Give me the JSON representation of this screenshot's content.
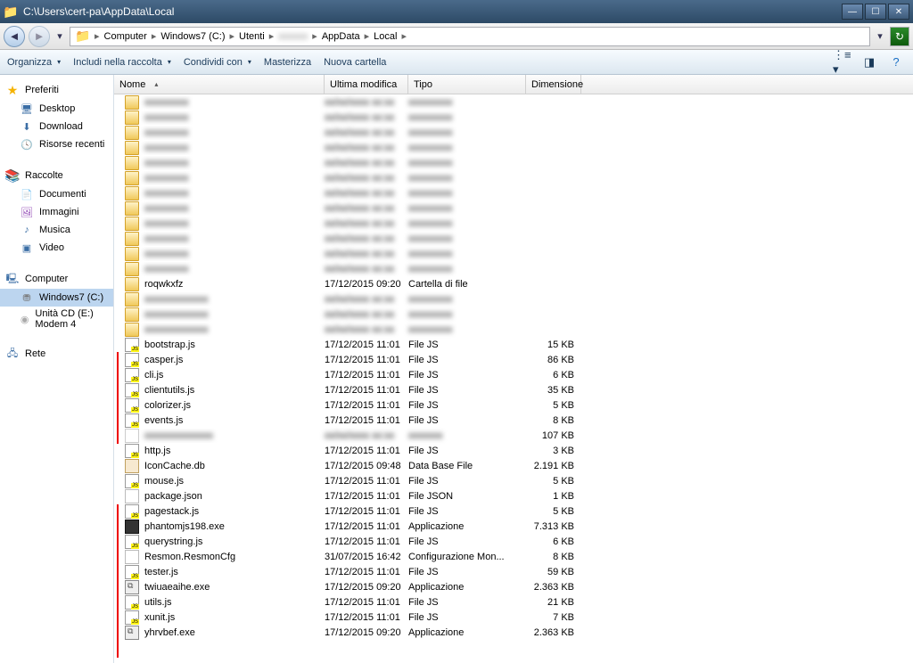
{
  "window": {
    "title": "C:\\Users\\cert-pa\\AppData\\Local"
  },
  "nav": {
    "crumbs": [
      "Computer",
      "Windows7 (C:)",
      "Utenti",
      "",
      "AppData",
      "Local"
    ]
  },
  "toolbar": {
    "organize": "Organizza",
    "include": "Includi nella raccolta",
    "share": "Condividi con",
    "burn": "Masterizza",
    "newfolder": "Nuova cartella"
  },
  "sidebar": {
    "favorites": "Preferiti",
    "desktop": "Desktop",
    "download": "Download",
    "recent": "Risorse recenti",
    "libraries": "Raccolte",
    "documents": "Documenti",
    "images": "Immagini",
    "music": "Musica",
    "video": "Video",
    "computer": "Computer",
    "drive_c": "Windows7 (C:)",
    "drive_cd": "Unità CD (E:) Modem 4",
    "network": "Rete"
  },
  "columns": {
    "name": "Nome",
    "modified": "Ultima modifica",
    "type": "Tipo",
    "size": "Dimensione"
  },
  "folders": {
    "roqwkxfz": {
      "name": "roqwkxfz",
      "modified": "17/12/2015 09:20",
      "type": "Cartella di file"
    }
  },
  "files": [
    {
      "name": "bootstrap.js",
      "modified": "17/12/2015 11:01",
      "type": "File JS",
      "size": "15 KB",
      "icon": "js"
    },
    {
      "name": "casper.js",
      "modified": "17/12/2015 11:01",
      "type": "File JS",
      "size": "86 KB",
      "icon": "js"
    },
    {
      "name": "cli.js",
      "modified": "17/12/2015 11:01",
      "type": "File JS",
      "size": "6 KB",
      "icon": "js"
    },
    {
      "name": "clientutils.js",
      "modified": "17/12/2015 11:01",
      "type": "File JS",
      "size": "35 KB",
      "icon": "js"
    },
    {
      "name": "colorizer.js",
      "modified": "17/12/2015 11:01",
      "type": "File JS",
      "size": "5 KB",
      "icon": "js"
    },
    {
      "name": "events.js",
      "modified": "17/12/2015 11:01",
      "type": "File JS",
      "size": "8 KB",
      "icon": "js"
    },
    {
      "name": "",
      "modified": "",
      "type": "",
      "size": "107 KB",
      "icon": "unknown",
      "blur": true
    },
    {
      "name": "http.js",
      "modified": "17/12/2015 11:01",
      "type": "File JS",
      "size": "3 KB",
      "icon": "js"
    },
    {
      "name": "IconCache.db",
      "modified": "17/12/2015 09:48",
      "type": "Data Base File",
      "size": "2.191 KB",
      "icon": "db"
    },
    {
      "name": "mouse.js",
      "modified": "17/12/2015 11:01",
      "type": "File JS",
      "size": "5 KB",
      "icon": "js"
    },
    {
      "name": "package.json",
      "modified": "17/12/2015 11:01",
      "type": "File JSON",
      "size": "1 KB",
      "icon": "json"
    },
    {
      "name": "pagestack.js",
      "modified": "17/12/2015 11:01",
      "type": "File JS",
      "size": "5 KB",
      "icon": "js"
    },
    {
      "name": "phantomjs198.exe",
      "modified": "17/12/2015 11:01",
      "type": "Applicazione",
      "size": "7.313 KB",
      "icon": "phantom"
    },
    {
      "name": "querystring.js",
      "modified": "17/12/2015 11:01",
      "type": "File JS",
      "size": "6 KB",
      "icon": "js"
    },
    {
      "name": "Resmon.ResmonCfg",
      "modified": "31/07/2015 16:42",
      "type": "Configurazione Mon...",
      "size": "8 KB",
      "icon": "cfg"
    },
    {
      "name": "tester.js",
      "modified": "17/12/2015 11:01",
      "type": "File JS",
      "size": "59 KB",
      "icon": "js"
    },
    {
      "name": "twiuaeaihe.exe",
      "modified": "17/12/2015 09:20",
      "type": "Applicazione",
      "size": "2.363 KB",
      "icon": "exe"
    },
    {
      "name": "utils.js",
      "modified": "17/12/2015 11:01",
      "type": "File JS",
      "size": "21 KB",
      "icon": "js"
    },
    {
      "name": "xunit.js",
      "modified": "17/12/2015 11:01",
      "type": "File JS",
      "size": "7 KB",
      "icon": "js"
    },
    {
      "name": "yhrvbef.exe",
      "modified": "17/12/2015 09:20",
      "type": "Applicazione",
      "size": "2.363 KB",
      "icon": "exe"
    }
  ]
}
